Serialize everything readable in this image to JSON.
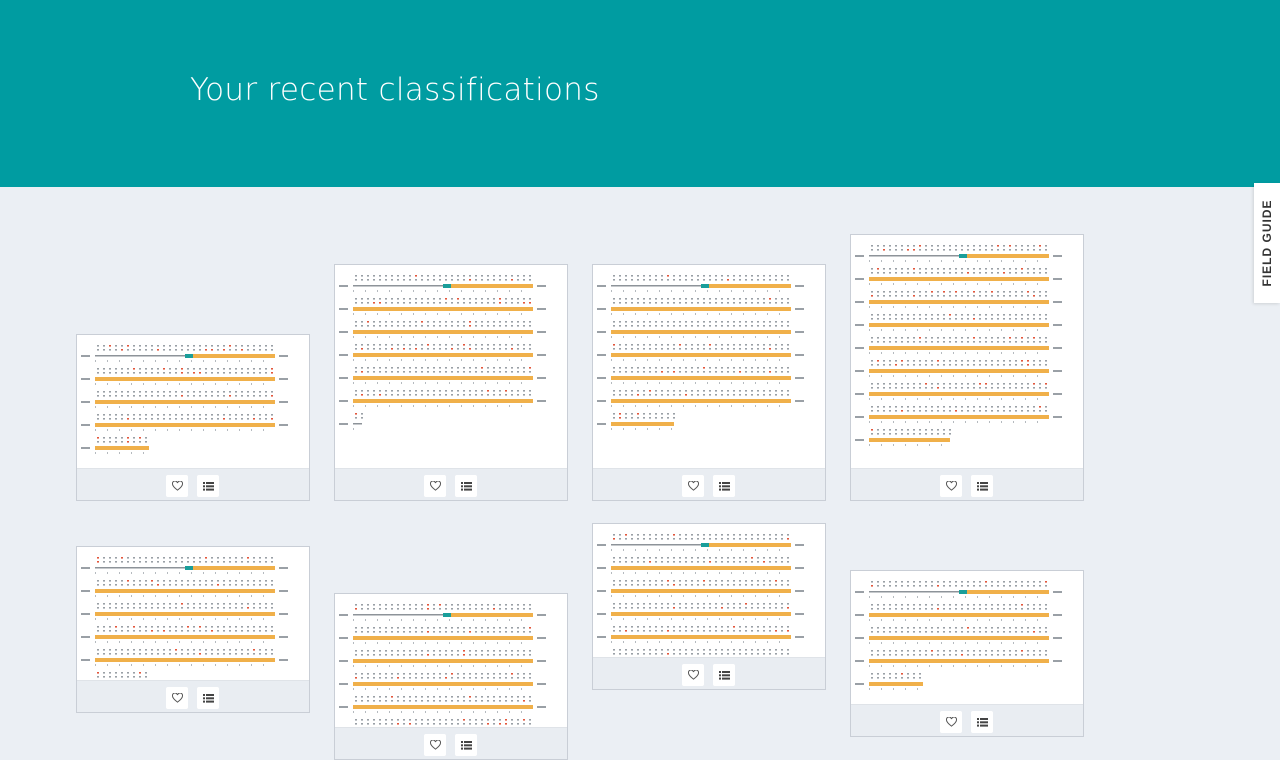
{
  "header": {
    "title": "Your recent classifications"
  },
  "field_guide": {
    "label": "FIELD GUIDE"
  },
  "cards": [
    {
      "id": 1,
      "rows": 5,
      "tail": 0.3
    },
    {
      "id": 2,
      "rows": 7,
      "tail": 0.05
    },
    {
      "id": 3,
      "rows": 7,
      "tail": 0.35
    },
    {
      "id": 4,
      "rows": 9,
      "tail": 0.45
    },
    {
      "id": 5,
      "rows": 6,
      "tail": 0.3
    },
    {
      "id": 6,
      "rows": 7,
      "tail": 0.3
    },
    {
      "id": 7,
      "rows": 7,
      "tail": 0.3
    },
    {
      "id": 8,
      "rows": 5,
      "tail": 0.3
    }
  ],
  "card_actions": {
    "favorite_icon": "heart-icon",
    "collect_icon": "list-icon"
  },
  "colors": {
    "header_bg": "#009ca1",
    "page_bg": "#ebeff4",
    "sequence_bar": "#f0b04a",
    "highlight": "#1a9e9a",
    "mark_red": "#e2573d"
  }
}
